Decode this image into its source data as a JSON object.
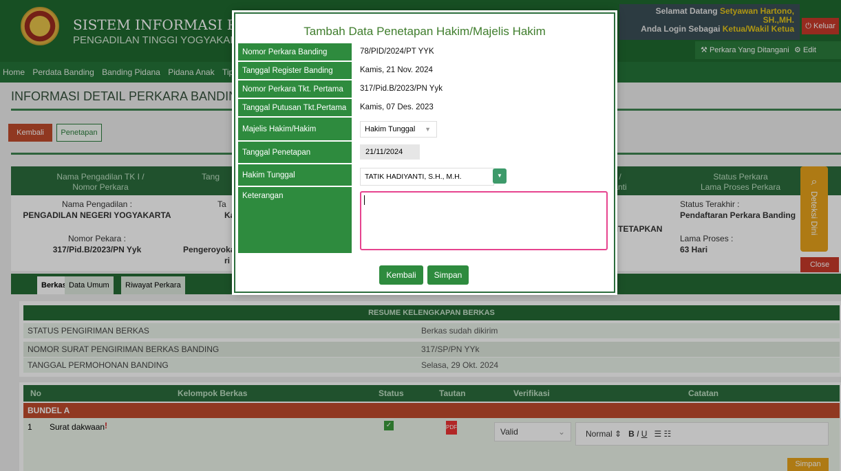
{
  "header": {
    "title": "SISTEM INFORMASI PENELUS",
    "subtitle": "PENGADILAN TINGGI YOGYAKARTA",
    "welcome_prefix": "Selamat Datang",
    "user_name": "Setyawan Hartono, SH.,MH.",
    "login_prefix": "Anda Login Sebagai",
    "role": "Ketua/Wakil Ketua",
    "logout": "Keluar",
    "handled_cases": "Perkara Yang Ditangani",
    "edit_profile": "Edit Profile"
  },
  "nav": [
    "Home",
    "Perdata Banding",
    "Banding Pidana",
    "Pidana Anak",
    "Tipik"
  ],
  "page": {
    "title": "INFORMASI DETAIL PERKARA BANDING",
    "back": "Kembali",
    "penetapan": "Penetapan"
  },
  "info": {
    "col1_head1": "Nama Pengadilan TK I /",
    "col1_head2": "Nomor Perkara",
    "col2_head": "Tang",
    "col5_head": "/",
    "col5_head2": "anti",
    "col6_head1": "Status Perkara",
    "col6_head2": "Lama Proses Perkara",
    "court_label": "Nama Pengadilan :",
    "court": "PENGADILAN NEGERI YOGYAKARTA",
    "no_label": "Nomor Pekara :",
    "no": "317/Pid.B/2023/PN Yyk",
    "t_label": "Ta",
    "t_val": "Kam",
    "j_val": "Pengeroyoka",
    "j_val2": "ri",
    "status_word": "DITETAPKAN",
    "status_label": "Status Terakhir :",
    "status": "Pendaftaran Perkara Banding",
    "lama_label": "Lama Proses :",
    "lama": "63 Hari",
    "deteksi": "Deteksi Dini",
    "close": "Close"
  },
  "tabs": [
    "Berkas",
    "Data Umum",
    "Riwayat Perkara"
  ],
  "resume": {
    "title": "RESUME KELENGKAPAN BERKAS",
    "rows": [
      {
        "label": "STATUS PENGIRIMAN BERKAS",
        "value": "Berkas sudah dikirim"
      },
      {
        "label": "NOMOR SURAT PENGIRIMAN BERKAS BANDING",
        "value": "317/SP/PN YYk"
      },
      {
        "label": "TANGGAL PERMOHONAN BANDING",
        "value": "Selasa, 29 Okt. 2024"
      }
    ]
  },
  "doc_table": {
    "headers": [
      "No",
      "Kelompok Berkas",
      "Status",
      "Tautan",
      "Verifikasi",
      "Catatan"
    ],
    "bundle": "BUNDEL A",
    "row": {
      "no": "1",
      "name": "Surat dakwaan",
      "mark": "!",
      "verification": "Valid",
      "editor_format": "Normal",
      "save": "Simpan"
    }
  },
  "modal": {
    "title": "Tambah Data Penetapan Hakim/Majelis Hakim",
    "fields": [
      {
        "label": "Nomor Perkara Banding",
        "value": "78/PID/2024/PT YYK"
      },
      {
        "label": "Tanggal Register Banding",
        "value": "Kamis, 21 Nov. 2024"
      },
      {
        "label": "Nomor Perkara Tkt. Pertama",
        "value": "317/Pid.B/2023/PN Yyk"
      },
      {
        "label": "Tanggal Putusan Tkt.Pertama",
        "value": "Kamis, 07 Des. 2023"
      },
      {
        "label": "Majelis Hakim/Hakim",
        "value": "Hakim Tunggal"
      },
      {
        "label": "Tanggal Penetapan",
        "value": "21/11/2024"
      },
      {
        "label": "Hakim Tunggal",
        "value": "TATIK HADIYANTI, S.H., M.H."
      },
      {
        "label": "Keterangan",
        "value": ""
      }
    ],
    "back": "Kembali",
    "save": "Simpan"
  },
  "colors": {
    "green": "#2e8b3e",
    "dark_green": "#1f6a2f",
    "red": "#c14b2d",
    "orange": "#e8a31b",
    "pink": "#e6438e"
  }
}
